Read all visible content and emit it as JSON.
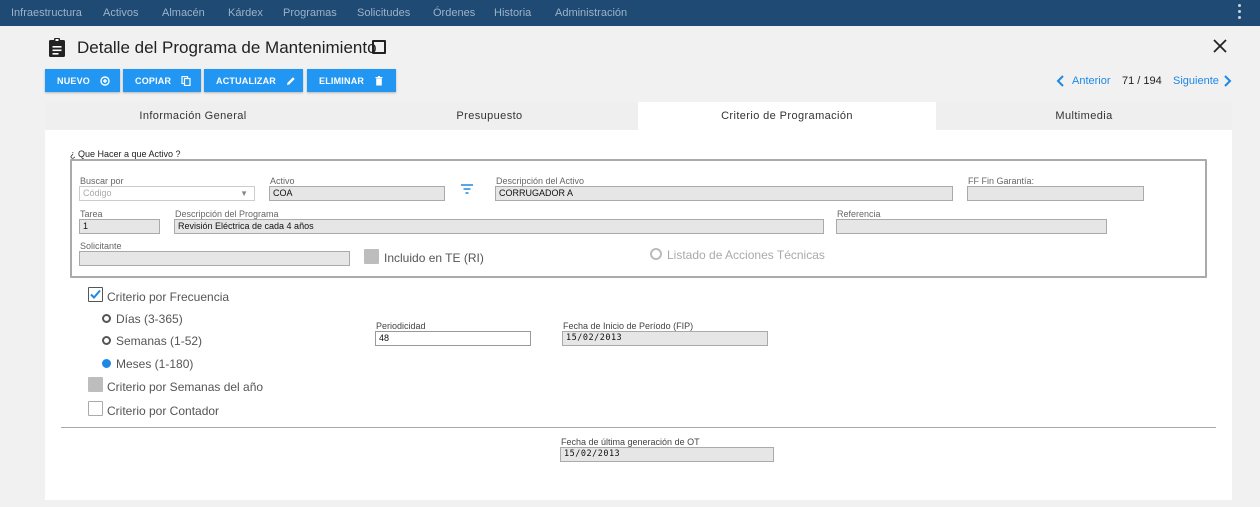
{
  "nav": {
    "items": [
      "Infraestructura",
      "Activos",
      "Almacén",
      "Kárdex",
      "Programas",
      "Solicitudes",
      "Órdenes",
      "Historia",
      "Administración"
    ]
  },
  "header": {
    "title": "Detalle del Programa de Mantenimiento"
  },
  "toolbar": {
    "nuevo": "NUEVO",
    "copiar": "COPIAR",
    "actualizar": "ACTUALIZAR",
    "eliminar": "ELIMINAR"
  },
  "pager": {
    "prev": "Anterior",
    "count": "71 / 194",
    "next": "Siguiente"
  },
  "tabs": [
    "Información General",
    "Presupuesto",
    "Criterio de Programación",
    "Multimedia"
  ],
  "active_tab": "Criterio de Programación",
  "section": {
    "title": "¿ Que Hacer a que Activo ?",
    "buscar_por_label": "Buscar por",
    "buscar_por_placeholder": "Código",
    "activo_label": "Activo",
    "activo_value": "COA",
    "desc_activo_label": "Descripción del Activo",
    "desc_activo_value": "CORRUGADOR A",
    "ff_garantia_label": "FF Fin Garantía:",
    "ff_garantia_value": "",
    "tarea_label": "Tarea",
    "tarea_value": "1",
    "desc_programa_label": "Descripción del Programa",
    "desc_programa_value": "Revisión Eléctrica de cada 4 años",
    "referencia_label": "Referencia",
    "referencia_value": "",
    "solicitante_label": "Solicitante",
    "solicitante_value": "",
    "incluido_label": "Incluido en TE (RI)",
    "listado_label": "Listado de Acciones Técnicas"
  },
  "criterio": {
    "frecuencia_label": "Criterio por Frecuencia",
    "frecuencia_checked": true,
    "dias_label": "Días (3-365)",
    "semanas_label": "Semanas (1-52)",
    "meses_label": "Meses (1-180)",
    "selected_period": "Meses (1-180)",
    "periodicidad_label": "Periodicidad",
    "periodicidad_value": "48",
    "fip_label": "Fecha de Inicio de Período (FIP)",
    "fip_value": "15/02/2013",
    "semanas_anio_label": "Criterio por Semanas del año",
    "contador_label": "Criterio por Contador",
    "ultima_ot_label": "Fecha de última generación de OT",
    "ultima_ot_value": "15/02/2013"
  },
  "colors": {
    "nav_bg": "#1e4a73",
    "accent": "#2196f3",
    "link": "#1e88e5"
  }
}
